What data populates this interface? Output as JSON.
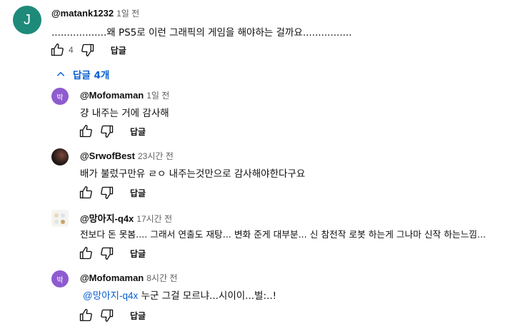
{
  "comment": {
    "avatar_letter": "J",
    "avatar_color": "#1e8a7a",
    "author": "@matank1232",
    "time": "1일 전",
    "text": "..................왜 PS5로 이런 그래픽의 게임을 해야하는 걸까요................",
    "likes": "4",
    "reply_label": "답글"
  },
  "replies_toggle": {
    "label": "답글 4개"
  },
  "replies": [
    {
      "avatar_text": "박",
      "avatar_color": "#8e5bd0",
      "author": "@Mofomaman",
      "time": "1일 전",
      "text": "걍 내주는 거에 감사해",
      "reply_label": "답글"
    },
    {
      "author": "@SrwofBest",
      "time": "23시간 전",
      "text": "배가 불렀구만유 ㄹㅇ 내주는것만으로 감사해야한다구요",
      "reply_label": "답글"
    },
    {
      "author": "@망아지-q4x",
      "time": "17시간 전",
      "text": "전보다 돈 못봄.... 그래서 연출도 재탕... 변화 준게 대부분... 신 참전작 로봇 하는게 그나마 신작 하는느낌...",
      "reply_label": "답글"
    },
    {
      "avatar_text": "박",
      "avatar_color": "#8e5bd0",
      "author": "@Mofomaman",
      "time": "8시간 전",
      "mention": "@망아지-q4x",
      "text": "누군 그걸 모르냐...시이이...벌:..!",
      "reply_label": "답글"
    }
  ]
}
